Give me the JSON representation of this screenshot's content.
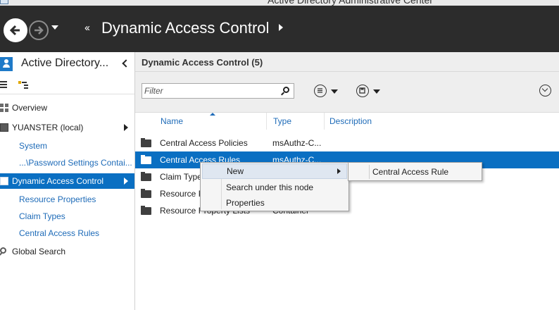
{
  "window": {
    "title": "Active Directory Administrative Center"
  },
  "header": {
    "breadcrumb_prefix": "‹‹",
    "breadcrumb_title": "Dynamic Access Control"
  },
  "leftnav": {
    "title": "Active Directory...",
    "items": [
      {
        "label": "Overview",
        "icon": "overview-grid-icon"
      },
      {
        "label": "YUANSTER (local)",
        "icon": "domain-icon",
        "has_arrow": true
      },
      {
        "label": "System",
        "indent": true
      },
      {
        "label": "...\\Password Settings Contai...",
        "indent": true
      },
      {
        "label": "Dynamic Access Control",
        "icon": "dac-icon",
        "selected": true,
        "has_arrow": true
      },
      {
        "label": "Resource Properties",
        "indent": true
      },
      {
        "label": "Claim Types",
        "indent": true
      },
      {
        "label": "Central Access Rules",
        "indent": true
      },
      {
        "label": "Global Search",
        "icon": "search-icon"
      }
    ]
  },
  "content": {
    "title": "Dynamic Access Control  (5)",
    "filter_placeholder": "Filter",
    "columns": [
      "Name",
      "Type",
      "Description"
    ],
    "rows": [
      {
        "name": "Central Access Policies",
        "type": "msAuthz-C..."
      },
      {
        "name": "Central Access Rules",
        "type": "msAuthz-C...",
        "selected": true
      },
      {
        "name": "Claim Types",
        "type": ""
      },
      {
        "name": "Resource Properties",
        "type": ""
      },
      {
        "name": "Resource Property Lists",
        "type": "Container"
      }
    ]
  },
  "context_menu": {
    "items": [
      "New",
      "Search under this node",
      "Properties"
    ],
    "submenu_items": [
      "Central Access Rule"
    ]
  },
  "colors": {
    "header_bg": "#2c2c2c",
    "selection": "#0a6fc2",
    "link": "#1e6bb8",
    "menu_hover": "#dfe7f1"
  }
}
